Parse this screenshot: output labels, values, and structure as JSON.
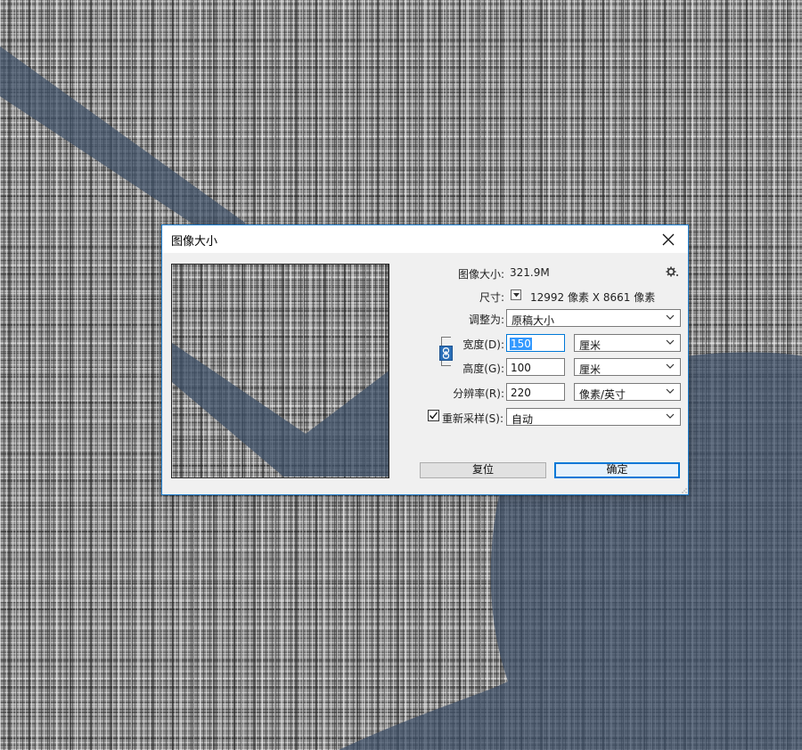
{
  "dialog": {
    "title": "图像大小",
    "close_icon": "close-icon",
    "image_size_label": "图像大小:",
    "image_size_value": "321.9M",
    "settings_icon": "gear-icon",
    "dimensions_label": "尺寸:",
    "dimensions_value": "12992 像素  X  8661 像素",
    "fit_to_label": "调整为:",
    "fit_to_value": "原稿大小",
    "width_label": "宽度(D):",
    "width_value": "150",
    "width_unit": "厘米",
    "height_label": "高度(G):",
    "height_value": "100",
    "height_unit": "厘米",
    "resolution_label": "分辨率(R):",
    "resolution_value": "220",
    "resolution_unit": "像素/英寸",
    "resample_label": "重新采样(S):",
    "resample_checked": true,
    "resample_value": "自动",
    "reset_button": "复位",
    "ok_button": "确定",
    "link_icon": "chain-link-icon"
  },
  "colors": {
    "accent": "#0078d7",
    "link_button": "#2a6fb8",
    "slate_shape": "#44556e",
    "selection": "#3399ff"
  }
}
